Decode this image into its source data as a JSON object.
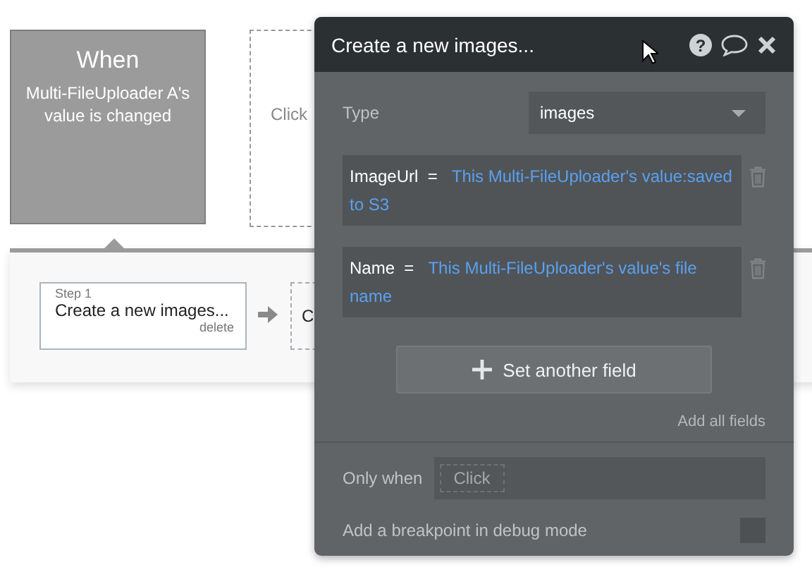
{
  "trigger": {
    "title": "When",
    "event": "Multi-FileUploader A's value is changed"
  },
  "placeholder_event": {
    "label": "Click"
  },
  "steps": [
    {
      "step": "Step 1",
      "title": "Create a new images...",
      "action": "delete"
    }
  ],
  "next_step": {
    "label": "C"
  },
  "panel": {
    "title": "Create a new images...",
    "help_icon": "?",
    "type_label": "Type",
    "type_value": "images",
    "fields": [
      {
        "name": "ImageUrl",
        "operator": "=",
        "value": "This Multi-FileUploader's value:saved to S3"
      },
      {
        "name": "Name",
        "operator": "=",
        "value": "This Multi-FileUploader's value's file name"
      }
    ],
    "set_another_field": "Set another field",
    "add_all_fields": "Add all fields",
    "only_when": {
      "label": "Only when",
      "placeholder": "Click"
    },
    "breakpoint": {
      "label": "Add a breakpoint in debug mode",
      "checked": false
    }
  }
}
